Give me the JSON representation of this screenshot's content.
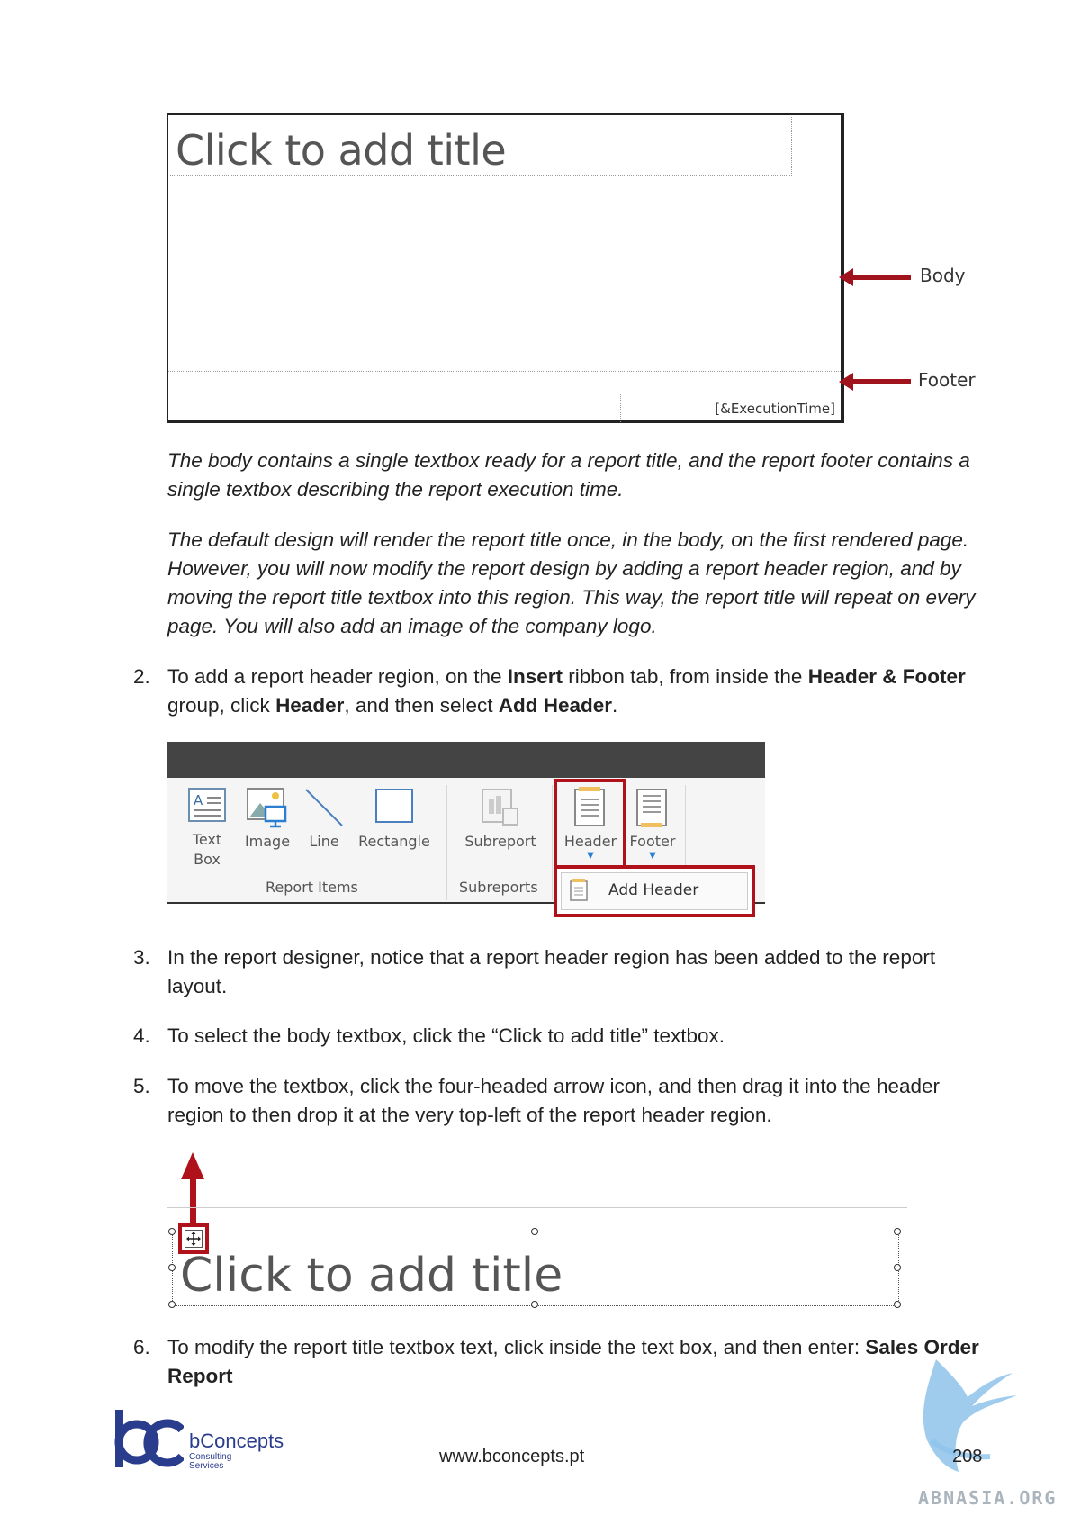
{
  "figure1": {
    "title_placeholder": "Click to add title",
    "execution_time": "[&ExecutionTime]",
    "callout_body": "Body",
    "callout_footer": "Footer"
  },
  "paragraphs": [
    "The body contains a single textbox ready for a report title, and the report footer contains a single textbox describing the report execution time.",
    "The default design will render the report title once, in the body, on the first rendered page. However, you will now modify the report design by adding a report header region, and by moving the report title textbox into this region. This way, the report title will repeat on every page. You will also add an image of the company logo."
  ],
  "steps": {
    "s2": {
      "num": "2.",
      "t1": "To add a report header region, on the ",
      "b1": "Insert",
      "t2": " ribbon tab, from inside the ",
      "b2": "Header & Footer",
      "t3": " group, click ",
      "b3": "Header",
      "t4": ", and then select ",
      "b4": "Add Header",
      "t5": "."
    },
    "s3": {
      "num": "3.",
      "text": "In the report designer, notice that a report header region has been added to the report layout."
    },
    "s4": {
      "num": "4.",
      "text": "To select the body textbox, click the “Click to add title” textbox."
    },
    "s5": {
      "num": "5.",
      "text": "To move the textbox, click the four-headed arrow icon, and then drag it into the header region to then drop it at the very top-left of the report header region."
    },
    "s6": {
      "num": "6.",
      "t1": "To modify the report title textbox text, click inside the text box, and then enter: ",
      "b1": "Sales Order Report"
    }
  },
  "ribbon": {
    "items": {
      "textbox": "Text Box",
      "image": "Image",
      "line": "Line",
      "rectangle": "Rectangle",
      "subreport": "Subreport",
      "header": "Header",
      "footer": "Footer"
    },
    "groups": {
      "report_items": "Report Items",
      "subreports": "Subreports"
    },
    "dropdown_item": "Add Header"
  },
  "figure3": {
    "title_placeholder": "Click to add title"
  },
  "footer": {
    "logo_name": "bConcepts",
    "logo_sub1": "Consulting",
    "logo_sub2": "Services",
    "url": "www.bconcepts.pt",
    "page_number": "208",
    "watermark": "ABNASIA.ORG"
  },
  "colors": {
    "accent_red": "#b0121c",
    "brand_blue": "#2a3c8c"
  }
}
